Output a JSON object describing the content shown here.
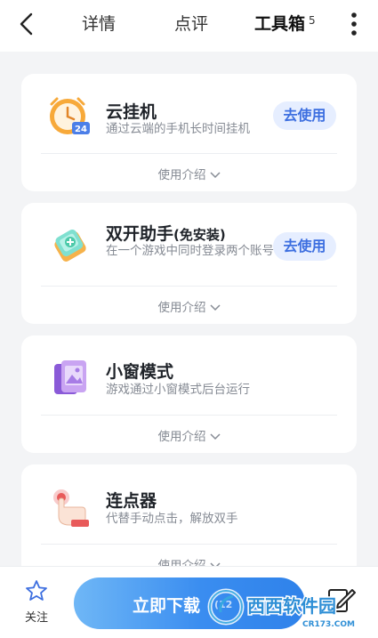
{
  "header": {
    "tabs": [
      {
        "label": "详情"
      },
      {
        "label": "点评"
      },
      {
        "label": "工具箱"
      }
    ],
    "tools_count": "5"
  },
  "tools": [
    {
      "title": "云挂机",
      "desc": "通过云端的手机长时间挂机",
      "button": "去使用",
      "intro": "使用介绍",
      "icon": "cloud-hangup-clock-icon"
    },
    {
      "title": "双开助手",
      "title_suffix": "(免安装)",
      "desc": "在一个游戏中同时登录两个账号",
      "button": "去使用",
      "intro": "使用介绍",
      "icon": "dual-open-phone-icon"
    },
    {
      "title": "小窗模式",
      "desc": "游戏通过小窗模式后台运行",
      "intro": "使用介绍",
      "icon": "small-window-icon"
    },
    {
      "title": "连点器",
      "desc": "代替手动点击，解放双手",
      "intro": "使用介绍",
      "icon": "auto-clicker-hand-icon"
    }
  ],
  "bottom": {
    "follow_label": "关注",
    "download_label": "立即下载",
    "download_size": "(12"
  },
  "watermark": {
    "name": "西西软件园",
    "url": "CR173.COM"
  },
  "colors": {
    "accent": "#3d6fe0",
    "button_bg": "#e6eeff",
    "page_bg": "#f3f4f6"
  }
}
